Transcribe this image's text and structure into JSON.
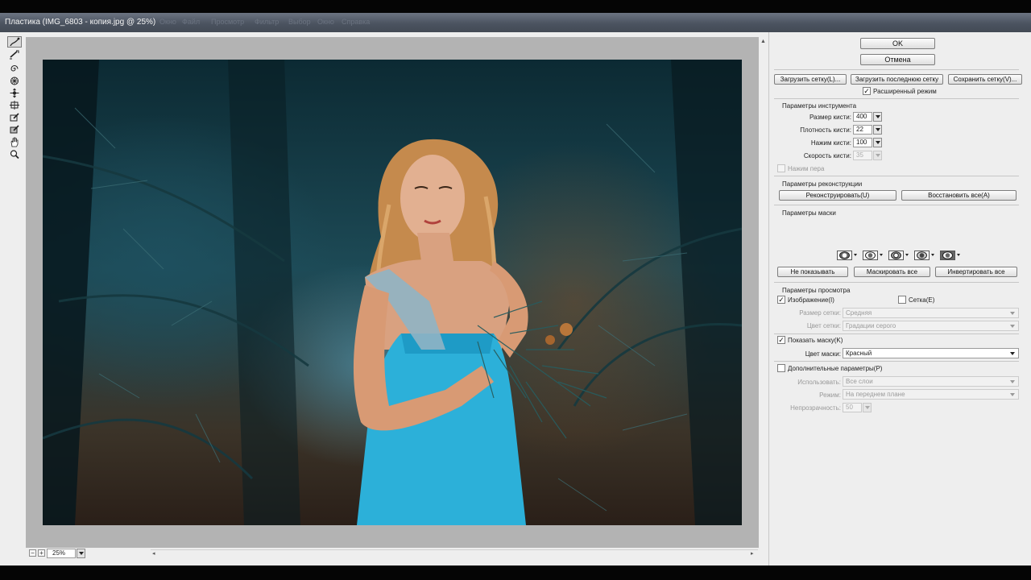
{
  "window": {
    "title": "Пластика (IMG_6803 - копия.jpg @ 25%)",
    "menu_ghost": [
      "Окно",
      "Файл",
      "Просмотр",
      "Фильтр",
      "Выбор",
      "Окно",
      "Справка"
    ]
  },
  "tools": [
    {
      "name": "forward-warp-tool-icon",
      "active": true
    },
    {
      "name": "reconstruct-tool-icon"
    },
    {
      "name": "twirl-tool-icon"
    },
    {
      "name": "pucker-tool-icon"
    },
    {
      "name": "bloat-tool-icon"
    },
    {
      "name": "push-left-tool-icon"
    },
    {
      "name": "freeze-mask-tool-icon"
    },
    {
      "name": "thaw-mask-tool-icon"
    },
    {
      "name": "hand-tool-icon"
    },
    {
      "name": "zoom-tool-icon"
    }
  ],
  "canvas": {
    "zoom_value": "25%",
    "zoom_out_symbol": "−",
    "zoom_in_symbol": "+"
  },
  "panel": {
    "ok_label": "OK",
    "cancel_label": "Отмена",
    "load_mesh_label": "Загрузить сетку(L)...",
    "load_last_mesh_label": "Загрузить последнюю сетку",
    "save_mesh_label": "Сохранить сетку(V)...",
    "advanced_mode": {
      "label": "Расширенный режим",
      "checked": true
    },
    "tool_options": {
      "title": "Параметры инструмента",
      "brush_size": {
        "label": "Размер кисти:",
        "value": "400"
      },
      "brush_density": {
        "label": "Плотность кисти:",
        "value": "22"
      },
      "brush_pressure": {
        "label": "Нажим кисти:",
        "value": "100"
      },
      "brush_rate": {
        "label": "Скорость кисти:",
        "value": "35"
      },
      "stylus_pressure": {
        "label": "Нажим пера",
        "checked": false
      }
    },
    "reconstruct_options": {
      "title": "Параметры реконструкции",
      "reconstruct_label": "Реконструировать(U)",
      "restore_all_label": "Восстановить все(A)"
    },
    "mask_options": {
      "title": "Параметры маски",
      "none_label": "Не показывать",
      "mask_all_label": "Маскировать все",
      "invert_all_label": "Инвертировать все"
    },
    "view_options": {
      "title": "Параметры просмотра",
      "show_image": {
        "label": "Изображение(I)",
        "checked": true
      },
      "show_mesh": {
        "label": "Сетка(E)",
        "checked": false
      },
      "mesh_size": {
        "label": "Размер сетки:",
        "value": "Средняя"
      },
      "mesh_color": {
        "label": "Цвет сетки:",
        "value": "Градации серого"
      },
      "show_mask": {
        "label": "Показать маску(K)",
        "checked": true
      },
      "mask_color": {
        "label": "Цвет маски:",
        "value": "Красный"
      }
    },
    "backdrop_options": {
      "title": "Дополнительные параметры(P)",
      "checked": false,
      "use": {
        "label": "Использовать:",
        "value": "Все слои"
      },
      "mode": {
        "label": "Режим:",
        "value": "На переднем плане"
      },
      "opacity": {
        "label": "Непрозрачность:",
        "value": "50"
      }
    }
  },
  "colors": {
    "titlebar": "#4b5360",
    "panel_bg": "#eeeeee",
    "canvas_bg": "#b3b3b3"
  }
}
